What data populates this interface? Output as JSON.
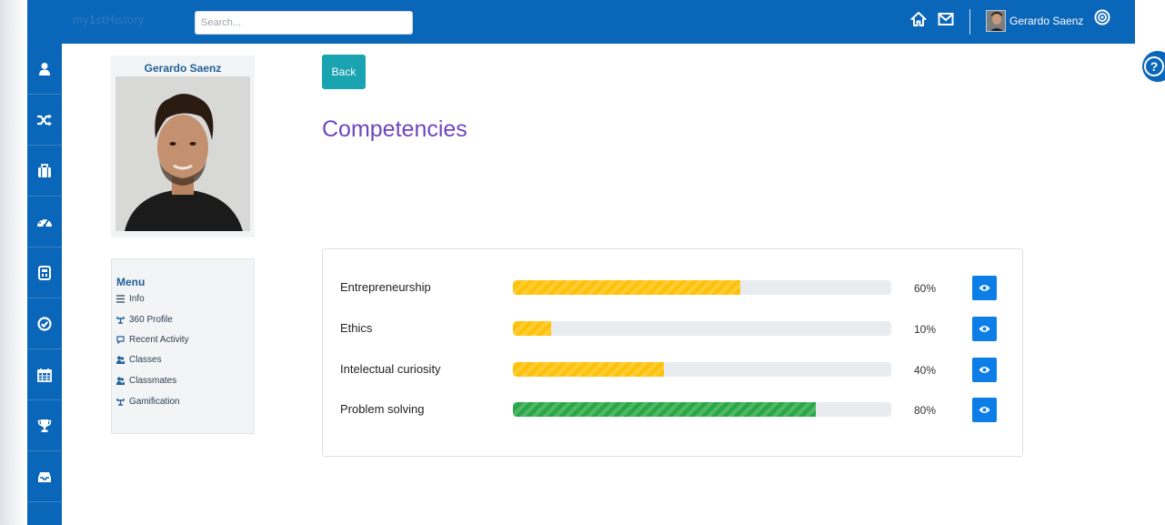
{
  "topbar": {
    "logo_text": "my1stHistory",
    "search_placeholder": "Search...",
    "user_name": "Gerardo Saenz"
  },
  "rail": {
    "icons": [
      "user-icon",
      "shuffle-icon",
      "briefcase-icon",
      "dashboard-icon",
      "calculator-icon",
      "check-circle-icon",
      "calendar-icon",
      "trophy-icon",
      "inbox-icon"
    ]
  },
  "profile": {
    "name": "Gerardo Saenz"
  },
  "menu": {
    "title": "Menu",
    "items": [
      {
        "label": "Info",
        "icon": "list-icon"
      },
      {
        "label": "360 Profile",
        "icon": "tree-icon"
      },
      {
        "label": "Recent Activity",
        "icon": "comment-icon"
      },
      {
        "label": "Classes",
        "icon": "users-icon"
      },
      {
        "label": "Classmates",
        "icon": "users-icon"
      },
      {
        "label": "Gamification",
        "icon": "tree-icon"
      }
    ]
  },
  "main": {
    "back_label": "Back",
    "title": "Competencies"
  },
  "competencies": [
    {
      "name": "Entrepreneurship",
      "percent": 60,
      "percent_label": "60%",
      "color": "#ffc107"
    },
    {
      "name": "Ethics",
      "percent": 10,
      "percent_label": "10%",
      "color": "#ffc107"
    },
    {
      "name": "Intelectual curiosity",
      "percent": 40,
      "percent_label": "40%",
      "color": "#ffc107"
    },
    {
      "name": "Problem solving",
      "percent": 80,
      "percent_label": "80%",
      "color": "#28a745"
    }
  ],
  "colors": {
    "brand_blue": "#0a66b8",
    "title_purple": "#6f46c2",
    "back_teal": "#1aa3b0",
    "view_blue": "#0d7ee8"
  }
}
